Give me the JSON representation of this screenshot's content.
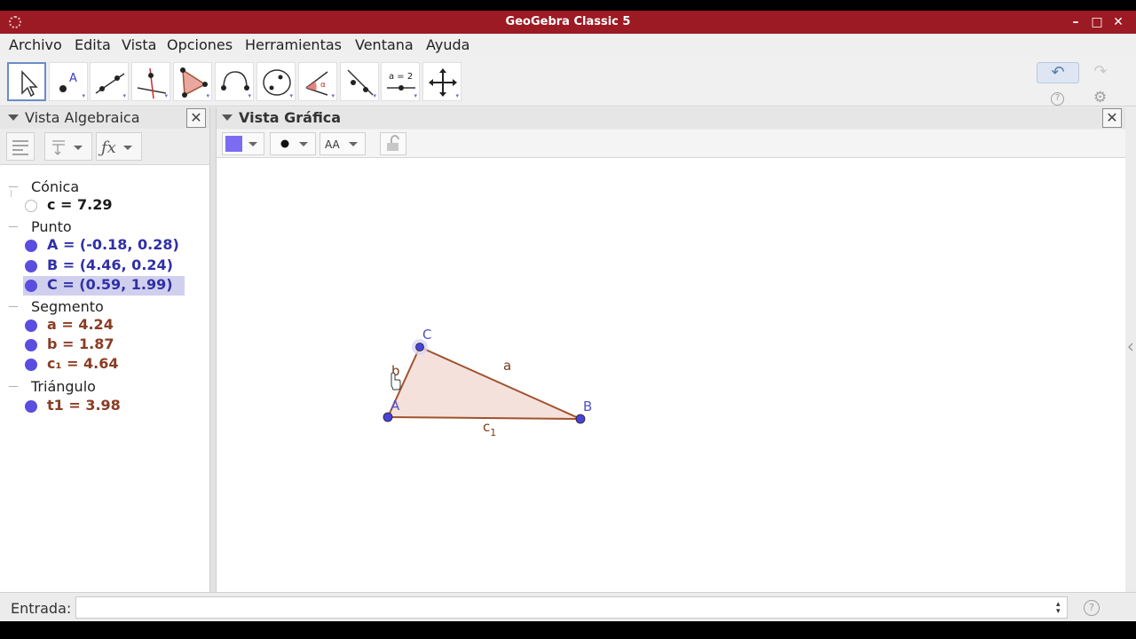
{
  "window": {
    "title": "GeoGebra Classic 5",
    "minimize": "–",
    "maximize": "□",
    "close": "✕"
  },
  "menu": [
    "Archivo",
    "Edita",
    "Vista",
    "Opciones",
    "Herramientas",
    "Ventana",
    "Ayuda"
  ],
  "toolbar": {
    "tools": [
      "move-tool",
      "point-tool",
      "line-tool",
      "perpendicular-tool",
      "polygon-tool",
      "circle-arc-tool",
      "conic-tool",
      "angle-tool",
      "reflect-tool",
      "slider-tool",
      "move-view-tool"
    ],
    "slider_label": "a = 2",
    "undo": "↶",
    "redo": "↷",
    "help": "?",
    "settings": "⚙"
  },
  "algebra": {
    "title": "Vista Algebraica",
    "categories": [
      {
        "name": "Cónica",
        "items": [
          {
            "text": "c = 7.29",
            "color": "#1a1a1a",
            "hollow": true
          }
        ]
      },
      {
        "name": "Punto",
        "items": [
          {
            "text": "A = (-0.18, 0.28)",
            "color": "#3030a8"
          },
          {
            "text": "B = (4.46, 0.24)",
            "color": "#3030a8"
          },
          {
            "text": "C = (0.59, 1.99)",
            "color": "#3030a8",
            "selected": true
          }
        ]
      },
      {
        "name": "Segmento",
        "items": [
          {
            "text": "a = 4.24",
            "color": "#8a3c22"
          },
          {
            "text": "b = 1.87",
            "color": "#8a3c22"
          },
          {
            "text": "c₁ = 4.64",
            "color": "#8a3c22"
          }
        ]
      },
      {
        "name": "Triángulo",
        "items": [
          {
            "text": "t1 = 3.98",
            "color": "#8a3c22"
          }
        ]
      }
    ]
  },
  "graphics": {
    "title": "Vista Gráfica",
    "style_text": "AA",
    "point_labels": {
      "A": "A",
      "B": "B",
      "C": "C"
    },
    "segment_labels": {
      "a": "a",
      "b": "b",
      "c": "c",
      "c_sub": "1"
    },
    "colors": {
      "point": "#4a42d8",
      "segment": "#a0522d",
      "fill": "#f5e1dc",
      "label_point": "#5050c8",
      "label_segment": "#7a3c18"
    }
  },
  "input": {
    "label": "Entrada:",
    "value": "",
    "placeholder": "",
    "help": "?"
  }
}
